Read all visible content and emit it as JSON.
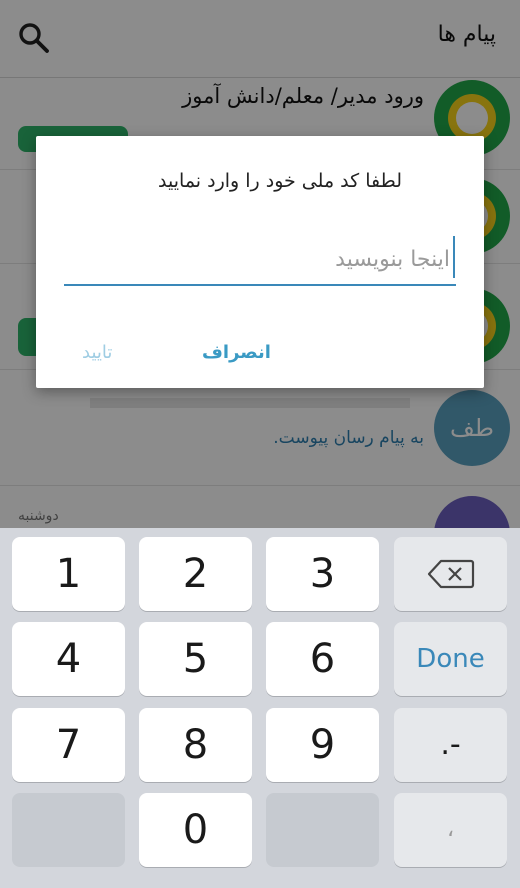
{
  "appbar": {
    "title": "پیام ها",
    "search_icon": "search-icon"
  },
  "list": {
    "rows": [
      {
        "title": "ورود مدیر/ معلم/دانش آموز"
      },
      {
        "initials": "طف",
        "message": "به پیام رسان پیوست.",
        "date": ""
      },
      {
        "date": "دوشنبه"
      }
    ]
  },
  "dialog": {
    "prompt": "لطفا کد ملی خود را وارد نمایید",
    "input_placeholder": "اینجا بنویسید",
    "input_value": "",
    "cancel_label": "انصراف",
    "ok_label": "تایید"
  },
  "keyboard": {
    "keys": [
      "1",
      "2",
      "3",
      "4",
      "5",
      "6",
      "7",
      "8",
      "9",
      "0"
    ],
    "done_label": "Done",
    "symbols_label": ".-",
    "comma_label": "،",
    "backspace_icon": "backspace-icon"
  },
  "colors": {
    "accent": "#3a88b9",
    "logo_green": "#22a84a",
    "logo_yellow": "#f7d31a",
    "avatar_blue": "#5aa0bf"
  }
}
